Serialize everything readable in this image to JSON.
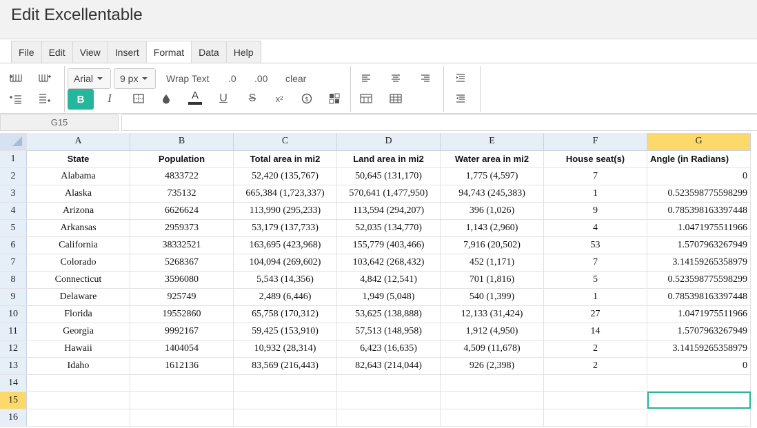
{
  "window": {
    "title": "Edit Excellentable"
  },
  "menu": [
    "File",
    "Edit",
    "View",
    "Insert",
    "Format",
    "Data",
    "Help"
  ],
  "toolbar": {
    "font_family": "Arial",
    "font_size": "9 px",
    "wrap_text": "Wrap Text",
    "decrease_decimal": ".0",
    "increase_decimal": ".00",
    "clear": "clear",
    "bold": "B",
    "italic": "I",
    "font_color_letter": "A",
    "underline": "U",
    "strikethrough": "S",
    "superscript": "x²",
    "accent_color": "#26b69b"
  },
  "formula": {
    "cell_ref": "G15",
    "value": ""
  },
  "grid": {
    "columns": [
      "A",
      "B",
      "C",
      "D",
      "E",
      "F",
      "G"
    ],
    "selected_column": "G",
    "selected_row": 15,
    "row_numbers": [
      1,
      2,
      3,
      4,
      5,
      6,
      7,
      8,
      9,
      10,
      11,
      12,
      13,
      14,
      15,
      16
    ],
    "header_row": [
      "State",
      "Population",
      "Total area in mi2",
      "Land area in mi2",
      "Water area in mi2",
      "House seat(s)",
      "Angle (in Radians)"
    ],
    "rows": [
      [
        "Alabama",
        "4833722",
        "52,420 (135,767)",
        "50,645 (131,170)",
        "1,775 (4,597)",
        "7",
        "0"
      ],
      [
        "Alaska",
        "735132",
        "665,384 (1,723,337)",
        "570,641 (1,477,950)",
        "94,743 (245,383)",
        "1",
        "0.523598775598299"
      ],
      [
        "Arizona",
        "6626624",
        "113,990 (295,233)",
        "113,594 (294,207)",
        "396 (1,026)",
        "9",
        "0.785398163397448"
      ],
      [
        "Arkansas",
        "2959373",
        "53,179 (137,733)",
        "52,035 (134,770)",
        "1,143 (2,960)",
        "4",
        "1.0471975511966"
      ],
      [
        "California",
        "38332521",
        "163,695 (423,968)",
        "155,779 (403,466)",
        "7,916 (20,502)",
        "53",
        "1.5707963267949"
      ],
      [
        "Colorado",
        "5268367",
        "104,094 (269,602)",
        "103,642 (268,432)",
        "452 (1,171)",
        "7",
        "3.14159265358979"
      ],
      [
        "Connecticut",
        "3596080",
        "5,543 (14,356)",
        "4,842 (12,541)",
        "701 (1,816)",
        "5",
        "0.523598775598299"
      ],
      [
        "Delaware",
        "925749",
        "2,489 (6,446)",
        "1,949 (5,048)",
        "540 (1,399)",
        "1",
        "0.785398163397448"
      ],
      [
        "Florida",
        "19552860",
        "65,758 (170,312)",
        "53,625 (138,888)",
        "12,133 (31,424)",
        "27",
        "1.0471975511966"
      ],
      [
        "Georgia",
        "9992167",
        "59,425 (153,910)",
        "57,513 (148,958)",
        "1,912 (4,950)",
        "14",
        "1.5707963267949"
      ],
      [
        "Hawaii",
        "1404054",
        "10,932 (28,314)",
        "6,423 (16,635)",
        "4,509 (11,678)",
        "2",
        "3.14159265358979"
      ],
      [
        "Idaho",
        "1612136",
        "83,569 (216,443)",
        "82,643 (214,044)",
        "926 (2,398)",
        "2",
        "0"
      ]
    ]
  }
}
